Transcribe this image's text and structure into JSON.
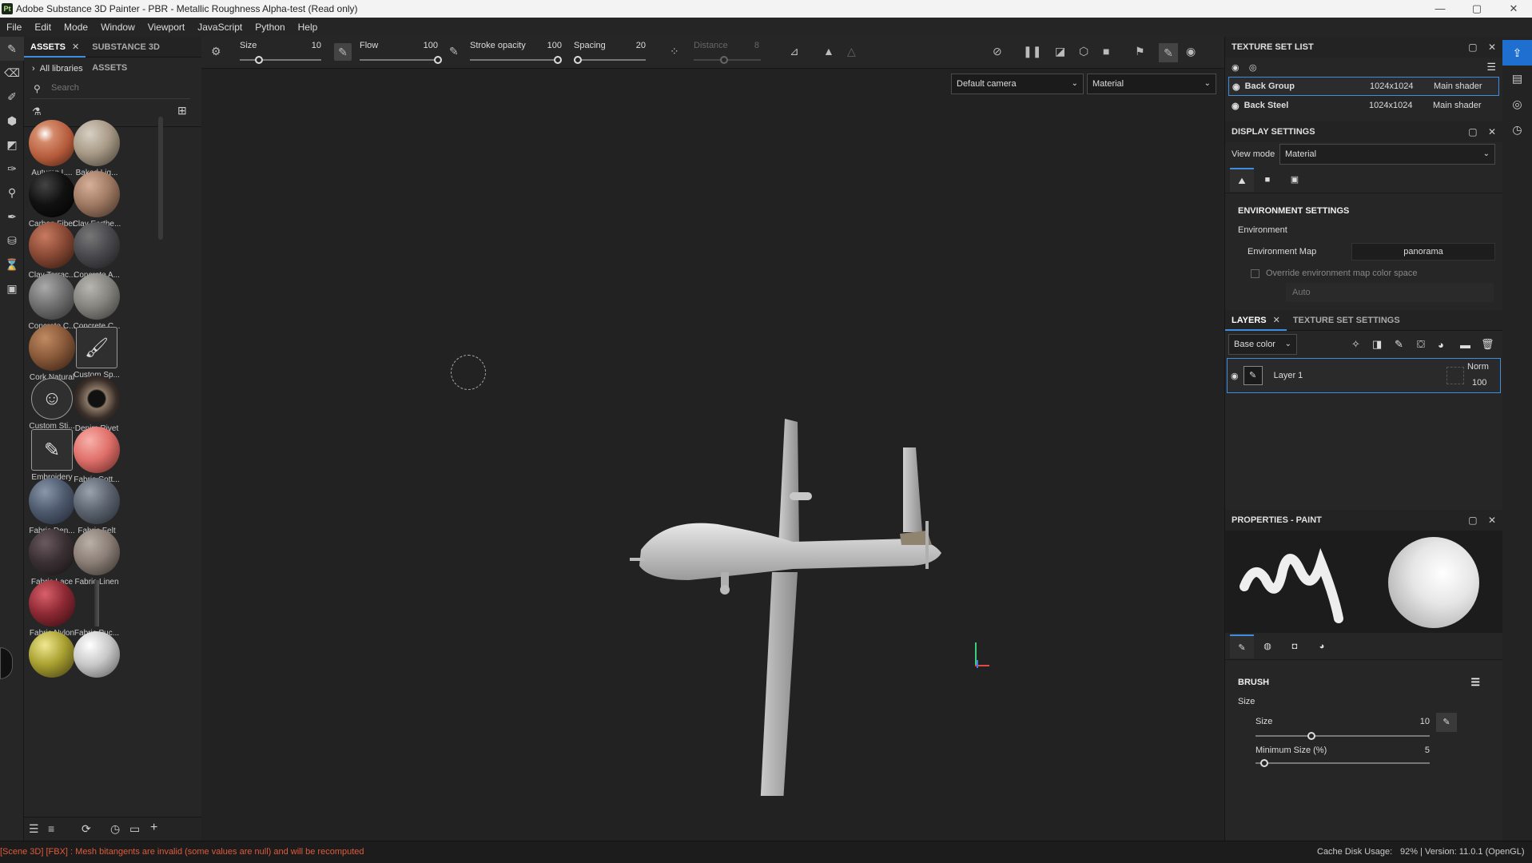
{
  "window": {
    "title": "Adobe Substance 3D Painter - PBR - Metallic Roughness Alpha-test (Read only)",
    "logo": "Pt",
    "controls": [
      "—",
      "▢",
      "✕"
    ]
  },
  "menu": [
    "File",
    "Edit",
    "Mode",
    "Window",
    "Viewport",
    "JavaScript",
    "Python",
    "Help"
  ],
  "assets": {
    "tabs": [
      {
        "label": "ASSETS",
        "close": "✕"
      },
      {
        "label": "SUBSTANCE 3D ASSETS"
      }
    ],
    "library": "All libraries",
    "search_placeholder": "Search",
    "items": [
      {
        "label": "Autumn L...",
        "color": "#b35a3a"
      },
      {
        "label": "Baked Lig...",
        "color": "#a89a86"
      },
      {
        "label": "Carbon Fiber",
        "color": "#111111"
      },
      {
        "label": "Clay Earthe...",
        "color": "#a07a63"
      },
      {
        "label": "Clay Terrac...",
        "color": "#8a4a36"
      },
      {
        "label": "Concrete A...",
        "color": "#4a4a4e"
      },
      {
        "label": "Concrete C...",
        "color": "#6f6f6f"
      },
      {
        "label": "Concrete C...",
        "color": "#86847e"
      },
      {
        "label": "Cork Natural",
        "color": "#8a5a3a"
      },
      {
        "label": "Custom Sp...",
        "icon": "🖌"
      },
      {
        "label": "Custom Sti...",
        "icon": "☺"
      },
      {
        "label": "Denim Rivet",
        "color": "#3a2e28"
      },
      {
        "label": "Embroidery",
        "icon": "✎"
      },
      {
        "label": "Fabric Cott...",
        "color": "#e0706a"
      },
      {
        "label": "Fabric Den...",
        "color": "#4e5a6e"
      },
      {
        "label": "Fabric Felt",
        "color": "#5c6470"
      },
      {
        "label": "Fabric Lace",
        "color": "#3a3034"
      },
      {
        "label": "Fabric Linen",
        "color": "#8a7e76"
      },
      {
        "label": "Fabric Nylon",
        "color": "#8e2a34"
      },
      {
        "label": "Fabric Puc...",
        "color": "#333333"
      },
      {
        "label": "",
        "color": "#a8a030"
      },
      {
        "label": "",
        "color": "#c8c8c8"
      }
    ]
  },
  "toolbar": {
    "size": {
      "label": "Size",
      "value": "10",
      "fraction": 0.24
    },
    "flow": {
      "label": "Flow",
      "value": "100",
      "fraction": 1.0
    },
    "stroke_opacity": {
      "label": "Stroke opacity",
      "value": "100",
      "fraction": 1.0
    },
    "spacing": {
      "label": "Spacing",
      "value": "20",
      "fraction": 0.05
    },
    "distance": {
      "label": "Distance",
      "value": "8",
      "fraction": 0.45
    }
  },
  "viewport": {
    "camera": "Default camera",
    "mode": "Material"
  },
  "texture_set_list": {
    "title": "TEXTURE SET LIST",
    "rows": [
      {
        "name": "Back Group",
        "res": "1024x1024",
        "shader": "Main shader"
      },
      {
        "name": "Back Steel",
        "res": "1024x1024",
        "shader": "Main shader"
      }
    ]
  },
  "display_settings": {
    "title": "DISPLAY SETTINGS",
    "view_mode_label": "View mode",
    "view_mode": "Material",
    "section": "ENVIRONMENT SETTINGS",
    "environment": "Environment",
    "env_map_label": "Environment Map",
    "env_map": "panorama",
    "override": "Override environment map color space",
    "auto": "Auto"
  },
  "layers": {
    "tabs": [
      {
        "label": "LAYERS",
        "close": "✕"
      },
      {
        "label": "TEXTURE SET SETTINGS"
      }
    ],
    "channel": "Base color",
    "layer": {
      "name": "Layer 1",
      "blend": "Norm",
      "opacity": "100"
    }
  },
  "properties": {
    "title": "PROPERTIES - PAINT",
    "section": "BRUSH",
    "size_group": "Size",
    "size": {
      "label": "Size",
      "value": "10",
      "fraction": 0.32
    },
    "min_size": {
      "label": "Minimum Size (%)",
      "value": "5",
      "fraction": 0.05
    }
  },
  "status": {
    "message": "[Scene 3D] [FBX] : Mesh bitangents are invalid (some values are null) and will be recomputed",
    "cache": "Cache Disk Usage:",
    "cache_value": "92% | Version: 11.0.1 (OpenGL)"
  },
  "colors": {
    "accent": "#3d8ee0",
    "error": "#e05a3a",
    "panel": "#262626"
  }
}
